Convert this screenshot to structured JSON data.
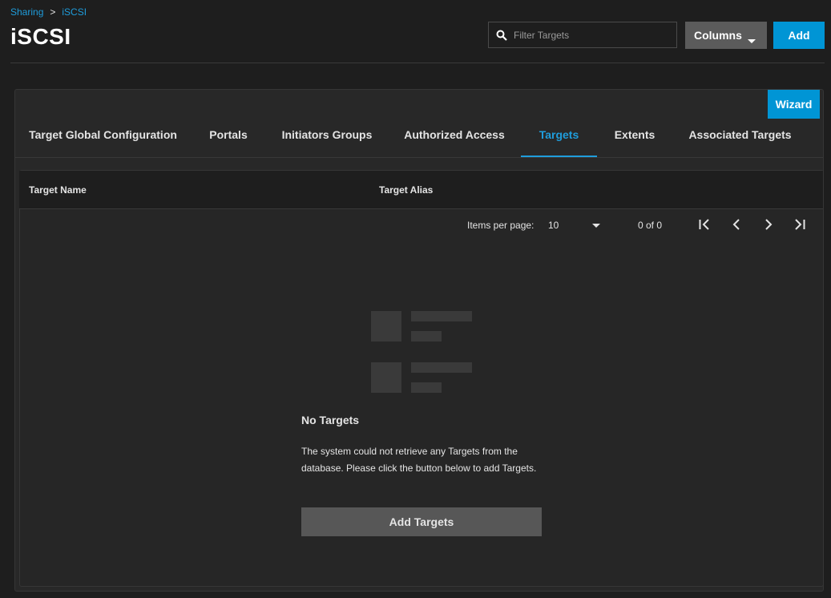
{
  "breadcrumb": {
    "parent": "Sharing",
    "separator": ">",
    "current": "iSCSI"
  },
  "page": {
    "title": "iSCSI"
  },
  "toolbar": {
    "filter_placeholder": "Filter Targets",
    "filter_value": "",
    "columns_label": "Columns",
    "add_label": "Add"
  },
  "card": {
    "wizard_label": "Wizard",
    "tabs": [
      {
        "label": "Target Global Configuration",
        "active": false
      },
      {
        "label": "Portals",
        "active": false
      },
      {
        "label": "Initiators Groups",
        "active": false
      },
      {
        "label": "Authorized Access",
        "active": false
      },
      {
        "label": "Targets",
        "active": true
      },
      {
        "label": "Extents",
        "active": false
      },
      {
        "label": "Associated Targets",
        "active": false
      }
    ]
  },
  "table": {
    "columns": [
      "Target Name",
      "Target Alias"
    ],
    "paginator": {
      "items_per_page_label": "Items per page:",
      "page_size": "10",
      "range_label": "0 of 0"
    }
  },
  "empty_state": {
    "title": "No Targets",
    "message": "The system could not retrieve any Targets from the database. Please click the button below to add Targets.",
    "button_label": "Add Targets"
  },
  "colors": {
    "accent": "#0095d5",
    "link": "#1f9ddc",
    "background": "#1e1e1e",
    "card": "#282828",
    "secondary_button": "#5b5b5b"
  },
  "icons": [
    "search-icon",
    "chevron-down-icon",
    "first-page-icon",
    "prev-page-icon",
    "next-page-icon",
    "last-page-icon",
    "empty-list-icon"
  ]
}
